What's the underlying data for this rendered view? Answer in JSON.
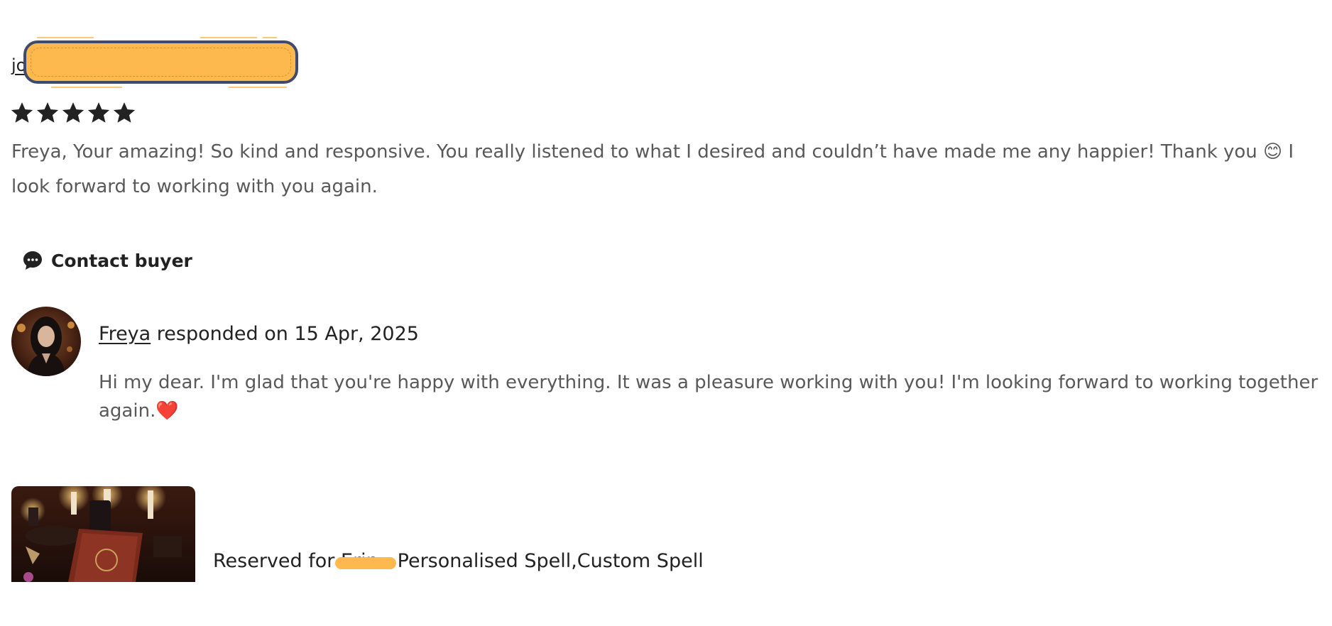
{
  "review": {
    "reviewer_visible_prefix": "jo",
    "rating": 5,
    "stars": [
      "★",
      "★",
      "★",
      "★",
      "★"
    ],
    "text": "Freya, Your amazing! So kind and responsive. You really listened to what I desired and couldn’t have made me any happier! Thank you 😊 I look forward to working with you again."
  },
  "contact": {
    "label": "Contact buyer",
    "icon": "chat-bubble-icon"
  },
  "response": {
    "seller_name": "Freya",
    "responded_text": " responded on 15 Apr, 2025",
    "text": "Hi my dear. I'm glad that you're happy with everything. It was a pleasure working with you! I'm looking forward to working together again.❤️"
  },
  "listing": {
    "title": "Reserved for Erin - Personalised Spell,Custom Spell"
  },
  "colors": {
    "redaction_fill": "#FDB94E",
    "redaction_border": "#3F4B6D",
    "text_primary": "#222222",
    "text_secondary": "#595959"
  }
}
